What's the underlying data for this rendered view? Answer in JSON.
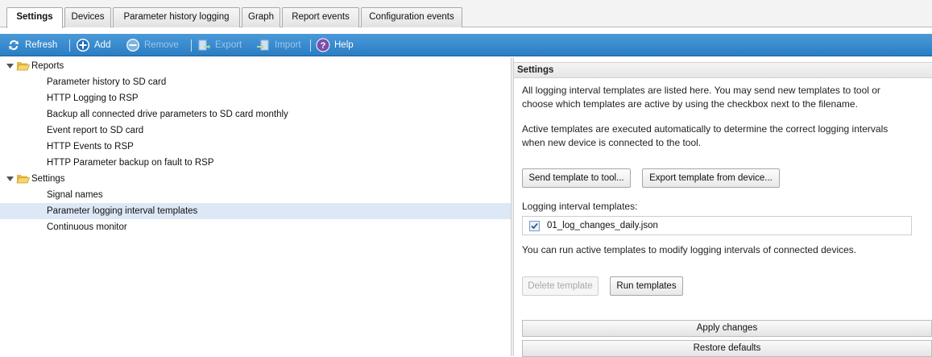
{
  "tabs": [
    {
      "label": "Settings",
      "active": true
    },
    {
      "label": "Devices"
    },
    {
      "label": "Parameter history logging"
    },
    {
      "label": "Graph"
    },
    {
      "label": "Report events"
    },
    {
      "label": "Configuration events"
    }
  ],
  "toolbar": {
    "refresh": "Refresh",
    "add": "Add",
    "remove": "Remove",
    "export": "Export",
    "import": "Import",
    "help": "Help"
  },
  "tree": {
    "reports_label": "Reports",
    "reports_items": [
      "Parameter history to SD card",
      "HTTP Logging to RSP",
      "Backup all connected drive parameters to SD card monthly",
      "Event report to SD card",
      "HTTP Events to RSP",
      "HTTP Parameter backup on fault to RSP"
    ],
    "settings_label": "Settings",
    "settings_items": [
      "Signal names",
      "Parameter logging interval templates",
      "Continuous monitor"
    ],
    "selected_item": "Parameter logging interval templates"
  },
  "panel": {
    "title": "Settings",
    "intro_1": "All logging interval templates are listed here. You may send new templates to tool or",
    "intro_2": "choose which templates are active by using the checkbox next to the filename.",
    "active_1": "Active templates are executed automatically to determine the correct logging intervals",
    "active_2": "when new device is connected to the tool.",
    "send_button": "Send template to tool...",
    "export_button": "Export template from device...",
    "templates_label": "Logging interval templates:",
    "templates": [
      {
        "name": "01_log_changes_daily.json",
        "checked": true
      }
    ],
    "run_info": "You can run active templates to modify logging intervals of connected devices.",
    "delete_button": "Delete template",
    "run_button": "Run templates",
    "apply_button": "Apply changes",
    "restore_button": "Restore defaults"
  },
  "colors": {
    "toolbar": "#2b7dc5",
    "selection": "#dde8f6",
    "folder": "#f2c94c"
  }
}
